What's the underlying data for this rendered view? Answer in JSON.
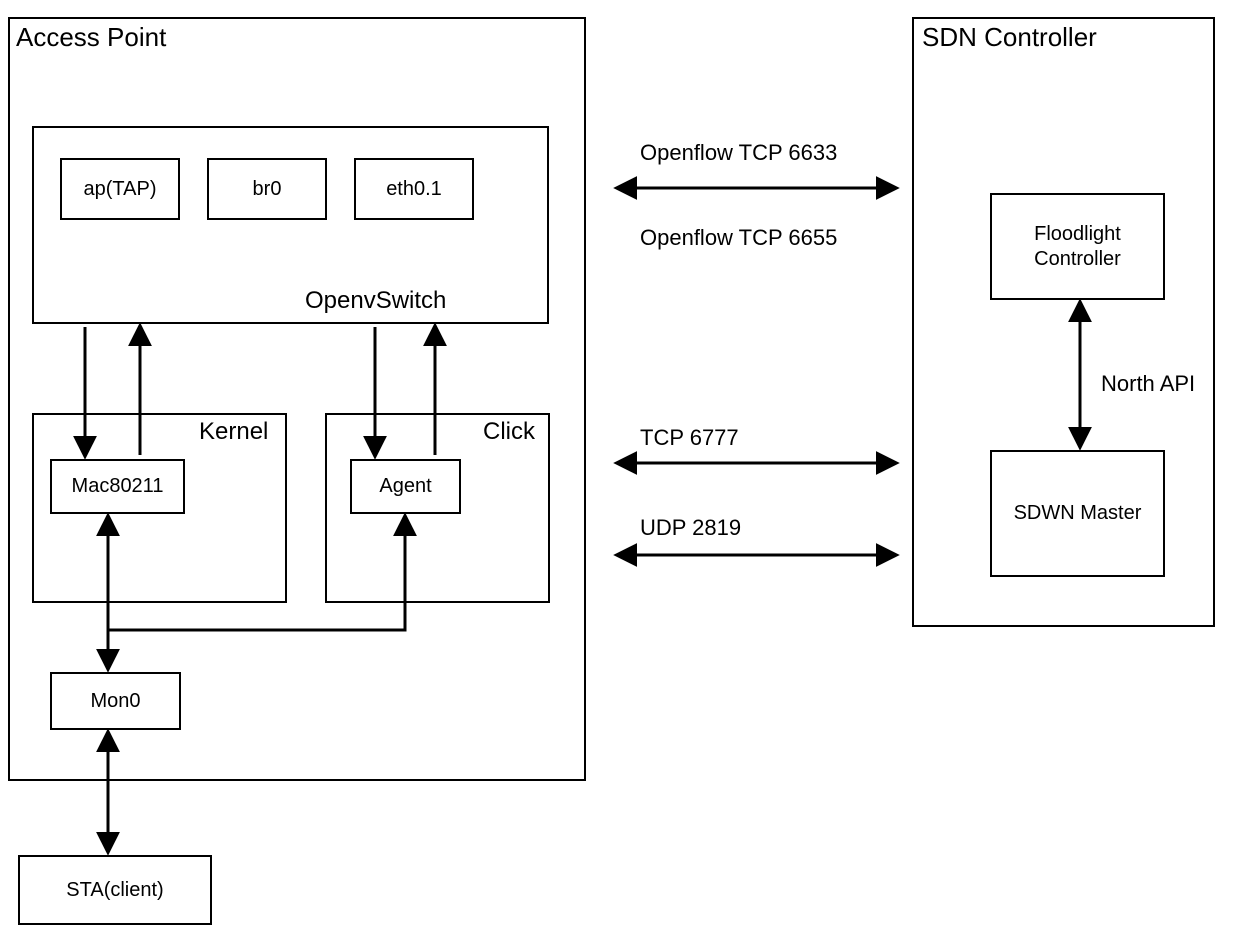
{
  "diagram": {
    "access_point": {
      "title": "Access Point",
      "openvswitch": {
        "title": "OpenvSwitch",
        "ap_tap": "ap(TAP)",
        "br0": "br0",
        "eth01": "eth0.1"
      },
      "kernel": {
        "title": "Kernel",
        "mac80211": "Mac80211"
      },
      "click": {
        "title": "Click",
        "agent": "Agent"
      },
      "mon0": "Mon0"
    },
    "sta_client": "STA(client)",
    "sdn_controller": {
      "title": "SDN Controller",
      "floodlight": "Floodlight Controller",
      "north_api": "North API",
      "sdwn_master": "SDWN Master"
    },
    "links": {
      "openflow_6633": "Openflow TCP 6633",
      "openflow_6655": "Openflow TCP 6655",
      "tcp_6777": "TCP 6777",
      "udp_2819": "UDP 2819"
    }
  }
}
